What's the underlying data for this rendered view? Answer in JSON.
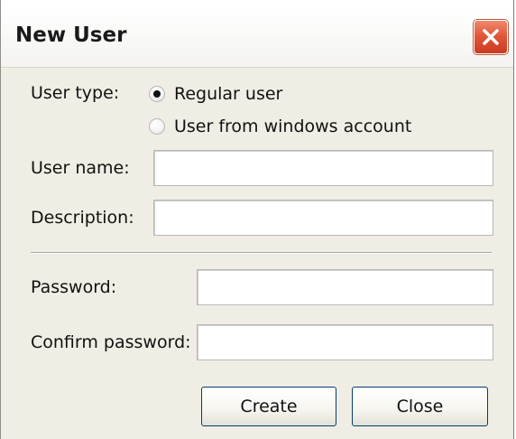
{
  "window": {
    "title": "New User",
    "close_icon": "close-icon"
  },
  "user_type": {
    "label": "User type:",
    "options": [
      {
        "label": "Regular user",
        "selected": true
      },
      {
        "label": "User from windows account",
        "selected": false
      }
    ]
  },
  "user_name": {
    "label": "User name:",
    "value": ""
  },
  "description": {
    "label": "Description:",
    "value": ""
  },
  "password": {
    "label": "Password:",
    "value": ""
  },
  "confirm_password": {
    "label": "Confirm password:",
    "value": ""
  },
  "buttons": {
    "create": "Create",
    "close": "Close"
  },
  "colors": {
    "dialog_background": "#f0eee4",
    "close_button": "#e2573a",
    "button_border": "#003c74"
  }
}
